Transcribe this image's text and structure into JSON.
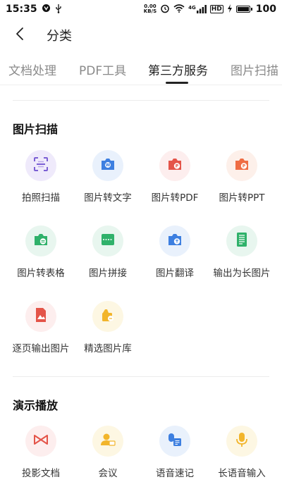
{
  "status_bar": {
    "time": "15:35",
    "net_speed_value": "0.00",
    "net_speed_unit": "KB/S",
    "network_type": "4G",
    "hd_label": "HD",
    "battery": "100",
    "icons": [
      "nfc-icon",
      "usb-icon",
      "alarm-icon",
      "wifi-icon",
      "signal-icon",
      "charging-icon",
      "battery-icon"
    ]
  },
  "header": {
    "title": "分类",
    "back_icon": "chevron-left-icon"
  },
  "tabs": [
    {
      "label": "文档处理",
      "active": false
    },
    {
      "label": "PDF工具",
      "active": false
    },
    {
      "label": "第三方服务",
      "active": true
    },
    {
      "label": "图片扫描",
      "active": false
    }
  ],
  "sections": [
    {
      "title": "图片扫描",
      "items": [
        {
          "label": "拍照扫描",
          "icon": "scan-frame-icon",
          "bg": "#efeafb",
          "color": "#7b5fd4"
        },
        {
          "label": "图片转文字",
          "icon": "camera-text-icon",
          "bg": "#e9f1fc",
          "color": "#3d7fe0"
        },
        {
          "label": "图片转PDF",
          "icon": "camera-pdf-icon",
          "bg": "#fdeeee",
          "color": "#e45449"
        },
        {
          "label": "图片转PPT",
          "icon": "camera-ppt-icon",
          "bg": "#fdf0ea",
          "color": "#ef6d44"
        },
        {
          "label": "图片转表格",
          "icon": "camera-table-icon",
          "bg": "#e8f6ef",
          "color": "#2fb16a"
        },
        {
          "label": "图片拼接",
          "icon": "image-stitch-icon",
          "bg": "#e8f6ef",
          "color": "#2fb16a"
        },
        {
          "label": "图片翻译",
          "icon": "camera-translate-icon",
          "bg": "#e9f1fc",
          "color": "#3d7fe0"
        },
        {
          "label": "输出为长图片",
          "icon": "long-image-icon",
          "bg": "#e8f6ef",
          "color": "#2fb16a"
        },
        {
          "label": "逐页输出图片",
          "icon": "page-image-icon",
          "bg": "#fdeeee",
          "color": "#e45449"
        },
        {
          "label": "精选图片库",
          "icon": "image-library-icon",
          "bg": "#fdf7e3",
          "color": "#f2b52b"
        }
      ]
    },
    {
      "title": "演示播放",
      "items": [
        {
          "label": "投影文档",
          "icon": "projector-bowtie-icon",
          "bg": "#fdeeee",
          "color": "#e45449"
        },
        {
          "label": "会议",
          "icon": "meeting-person-icon",
          "bg": "#fdf7e3",
          "color": "#f2b52b"
        },
        {
          "label": "语音速记",
          "icon": "voice-note-icon",
          "bg": "#e9f1fc",
          "color": "#3d7fe0"
        },
        {
          "label": "长语音输入",
          "icon": "microphone-icon",
          "bg": "#fdf7e3",
          "color": "#f2b52b"
        }
      ]
    }
  ]
}
